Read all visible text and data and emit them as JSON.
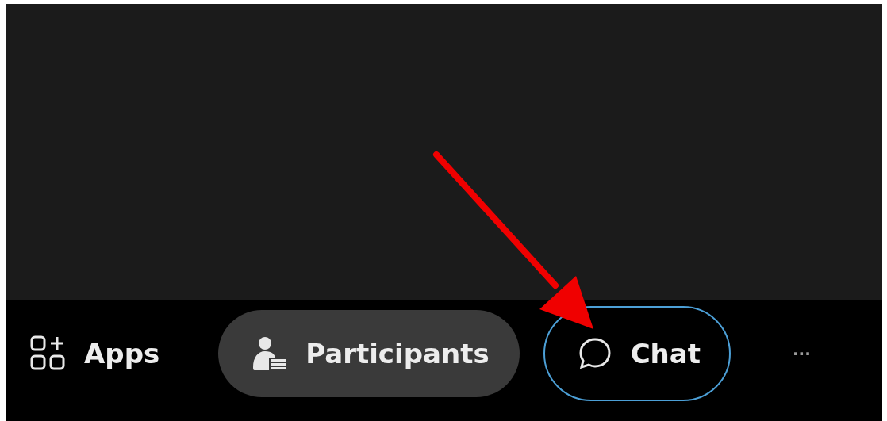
{
  "controls": [
    {
      "kind": "apps",
      "label": "Apps",
      "selected": false,
      "focused": false
    },
    {
      "kind": "participants",
      "label": "Participants",
      "selected": true,
      "focused": false
    },
    {
      "kind": "chat",
      "label": "Chat",
      "selected": false,
      "focused": true
    },
    {
      "kind": "more",
      "label": "···",
      "selected": false,
      "focused": false
    }
  ]
}
